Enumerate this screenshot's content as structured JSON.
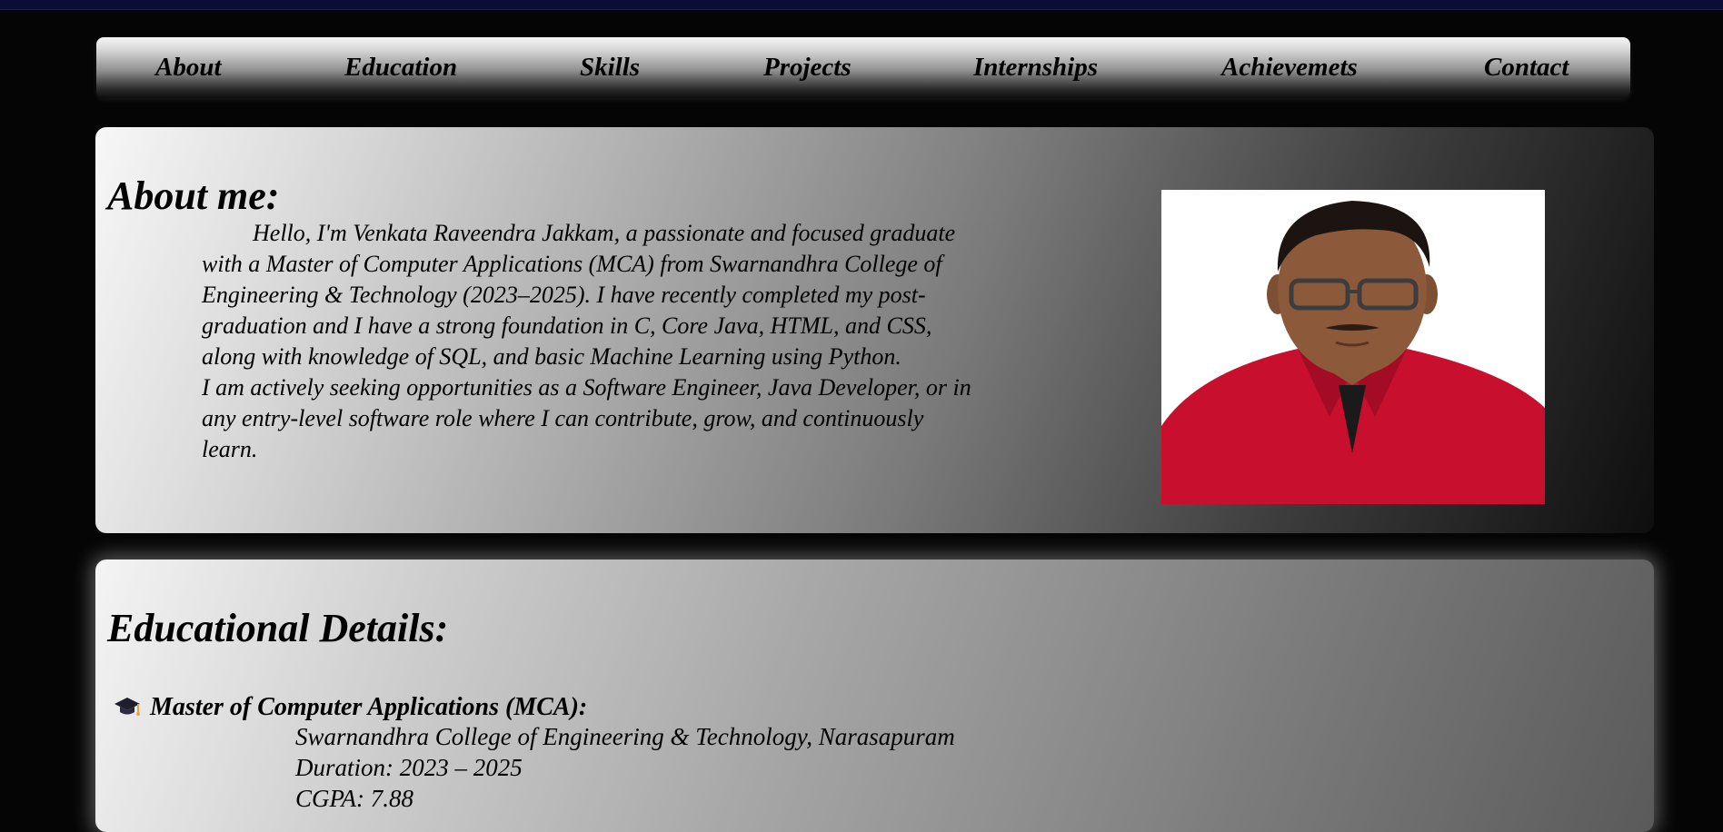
{
  "nav": {
    "items": [
      "About",
      "Education",
      "Skills",
      "Projects",
      "Internships",
      "Achievemets",
      "Contact"
    ]
  },
  "about": {
    "title": "About me:",
    "paragraph1": "Hello, I'm Venkata Raveendra Jakkam, a passionate and focused graduate with a Master of Computer Applications (MCA) from Swarnandhra College of Engineering & Technology (2023–2025). I have recently completed my post-graduation and I have a strong foundation in C, Core Java, HTML, and CSS, along with knowledge of SQL, and basic Machine Learning using Python.",
    "paragraph2": "I am actively seeking opportunities as a Software Engineer, Java Developer, or in any entry-level software role where I can contribute, grow, and continuously learn.",
    "photo_icon": "profile-photo"
  },
  "education": {
    "title": "Educational Details:",
    "items": [
      {
        "icon": "graduation-cap-icon",
        "degree": "Master of Computer Applications (MCA):",
        "college": "Swarnandhra College of Engineering & Technology, Narasapuram",
        "duration": "Duration: 2023 – 2025",
        "cgpa": "CGPA: 7.88"
      }
    ]
  },
  "colors": {
    "top_strip": "#0b0d33",
    "background": "#050505",
    "shirt": "#c8102e"
  }
}
